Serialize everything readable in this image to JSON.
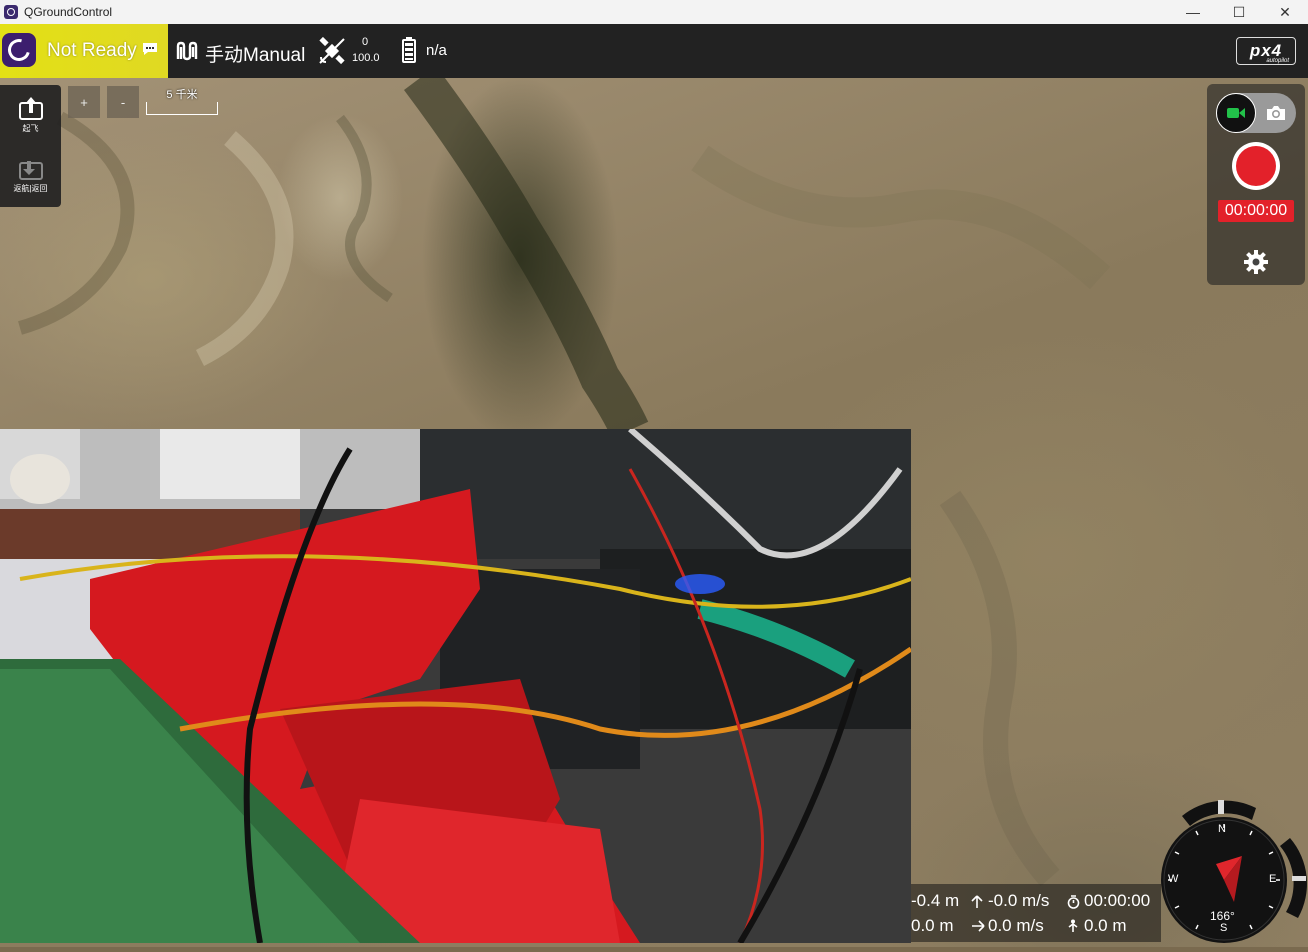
{
  "window": {
    "title": "QGroundControl"
  },
  "toolbar": {
    "ready_status": "Not Ready",
    "flight_mode": "手动Manual",
    "gps_count": "0",
    "gps_hdop": "100.0",
    "battery": "n/a",
    "brand": "px4",
    "brand_sub": "autopilot"
  },
  "left_tools": {
    "takeoff_label": "起飞",
    "rtl_label": "返航|返回"
  },
  "map": {
    "zoom_in": "+",
    "zoom_out": "-",
    "scale_label": "5 千米"
  },
  "camera": {
    "record_time": "00:00:00"
  },
  "telemetry": {
    "altitude": "-0.4 m",
    "vertical_speed": "-0.0 m/s",
    "flight_time": "00:00:00",
    "distance": "0.0 m",
    "horizontal_speed": "0.0 m/s",
    "home_distance": "0.0 m"
  },
  "compass": {
    "north": "N",
    "south": "S",
    "east": "E",
    "west": "W",
    "heading": "166°"
  },
  "colors": {
    "ready_bg": "#e3e015",
    "toolbar_bg": "#222222",
    "record_red": "#e3212a",
    "video_active_green": "#22c24a"
  }
}
